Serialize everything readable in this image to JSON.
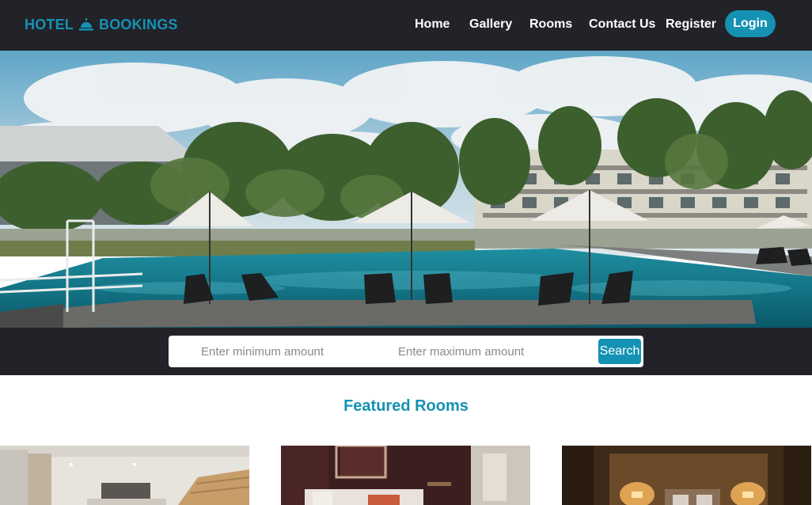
{
  "brand": {
    "text_left": "HOTEL",
    "text_right": "BOOKINGS",
    "icon": "bell-icon"
  },
  "nav": {
    "items": [
      {
        "label": "Home"
      },
      {
        "label": "Gallery"
      },
      {
        "label": "Rooms"
      },
      {
        "label": "Contact Us"
      },
      {
        "label": "Register"
      }
    ],
    "login_label": "Login"
  },
  "search": {
    "min_placeholder": "Enter minimum amount",
    "max_placeholder": "Enter maximum amount",
    "button_label": "Search"
  },
  "featured": {
    "title": "Featured Rooms",
    "rooms": [
      {
        "image": "living-room-photo"
      },
      {
        "image": "bedroom-photo"
      },
      {
        "image": "bedroom-lamps-photo"
      }
    ]
  },
  "colors": {
    "accent": "#1592b3",
    "nav_bg": "#222229"
  }
}
